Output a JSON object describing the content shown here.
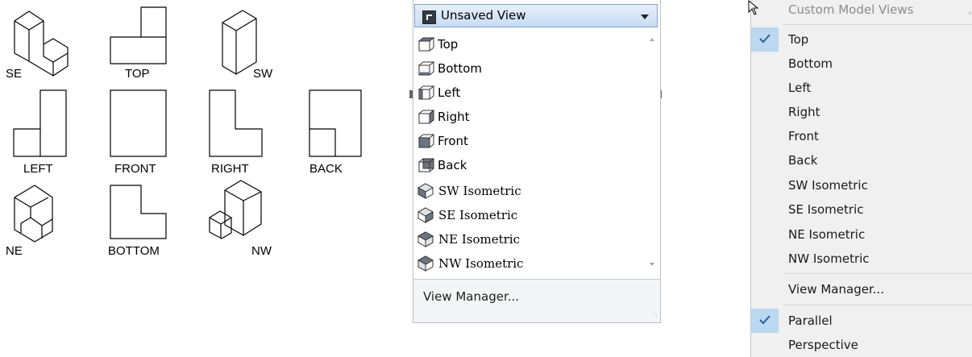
{
  "view_labels": {
    "se": "SE",
    "top": "TOP",
    "sw": "SW",
    "left": "LEFT",
    "front": "FRONT",
    "right": "RIGHT",
    "back": "BACK",
    "ne": "NE",
    "bottom": "BOTTOM",
    "nw": "NW"
  },
  "dropdown": {
    "selected": "Unsaved View",
    "items": [
      {
        "label": "Top",
        "icon": "top-view-icon"
      },
      {
        "label": "Bottom",
        "icon": "bottom-view-icon"
      },
      {
        "label": "Left",
        "icon": "left-view-icon"
      },
      {
        "label": "Right",
        "icon": "right-view-icon"
      },
      {
        "label": "Front",
        "icon": "front-view-icon"
      },
      {
        "label": "Back",
        "icon": "back-view-icon"
      },
      {
        "label": "SW Isometric",
        "icon": "sw-isometric-icon"
      },
      {
        "label": "SE Isometric",
        "icon": "se-isometric-icon"
      },
      {
        "label": "NE Isometric",
        "icon": "ne-isometric-icon"
      },
      {
        "label": "NW Isometric",
        "icon": "nw-isometric-icon"
      }
    ],
    "footer": "View Manager..."
  },
  "context_menu": {
    "header": "Custom Model Views",
    "items": [
      "Top",
      "Bottom",
      "Left",
      "Right",
      "Front",
      "Back",
      "SW Isometric",
      "SE Isometric",
      "NE Isometric",
      "NW Isometric"
    ],
    "checked_view": "Top",
    "view_manager": "View Manager...",
    "projection": [
      "Parallel",
      "Perspective"
    ],
    "checked_projection": "Parallel"
  },
  "colors": {
    "selection": "#bcd7f0",
    "header_border": "#7da2ce",
    "menu_bg": "#f0f0f0"
  }
}
